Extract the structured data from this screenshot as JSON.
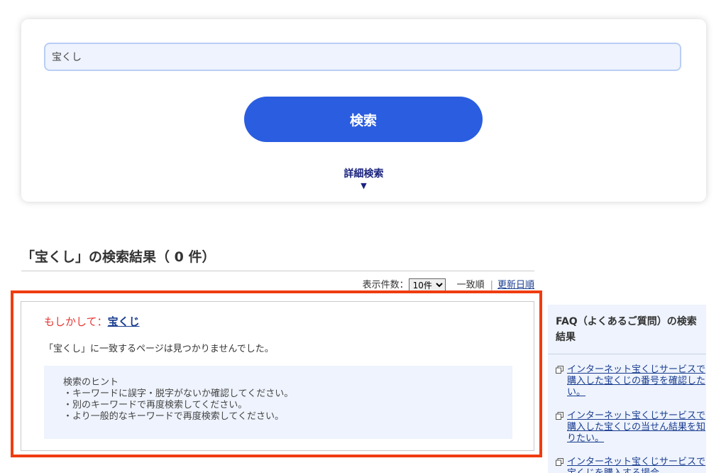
{
  "search": {
    "value": "宝くし",
    "button_label": "検索",
    "advanced_label": "詳細検索",
    "advanced_caret": "▼"
  },
  "results": {
    "title": "「宝くし」の検索結果（ 0 件）",
    "per_page_label": "表示件数：",
    "per_page_selected": "10件",
    "sort_relevance": "一致順",
    "sort_separator": "|",
    "sort_updated": "更新日順"
  },
  "suggestion": {
    "prefix": "もしかして：",
    "link": "宝くじ"
  },
  "no_match_text": "「宝くし」に一致するページは見つかりませんでした。",
  "hints": {
    "title": "検索のヒント",
    "items": [
      "・キーワードに誤字・脱字がないか確認してください。",
      "・別のキーワードで再度検索してください。",
      "・より一般的なキーワードで再度検索してください。"
    ]
  },
  "faq": {
    "title": "FAQ（よくあるご質問）の検索結果",
    "items": [
      "インターネット宝くじサービスで購入した宝くじの番号を確認したい。",
      "インターネット宝くじサービスで購入した宝くじの当せん結果を知りたい。",
      "インターネット宝くじサービスで宝くじを購入する場合"
    ]
  },
  "colors": {
    "accent": "#2a5de0",
    "highlight": "#f03c10",
    "suggestion": "#e53935",
    "link": "#1a3d8f",
    "panel_bg": "#eef3fd"
  }
}
